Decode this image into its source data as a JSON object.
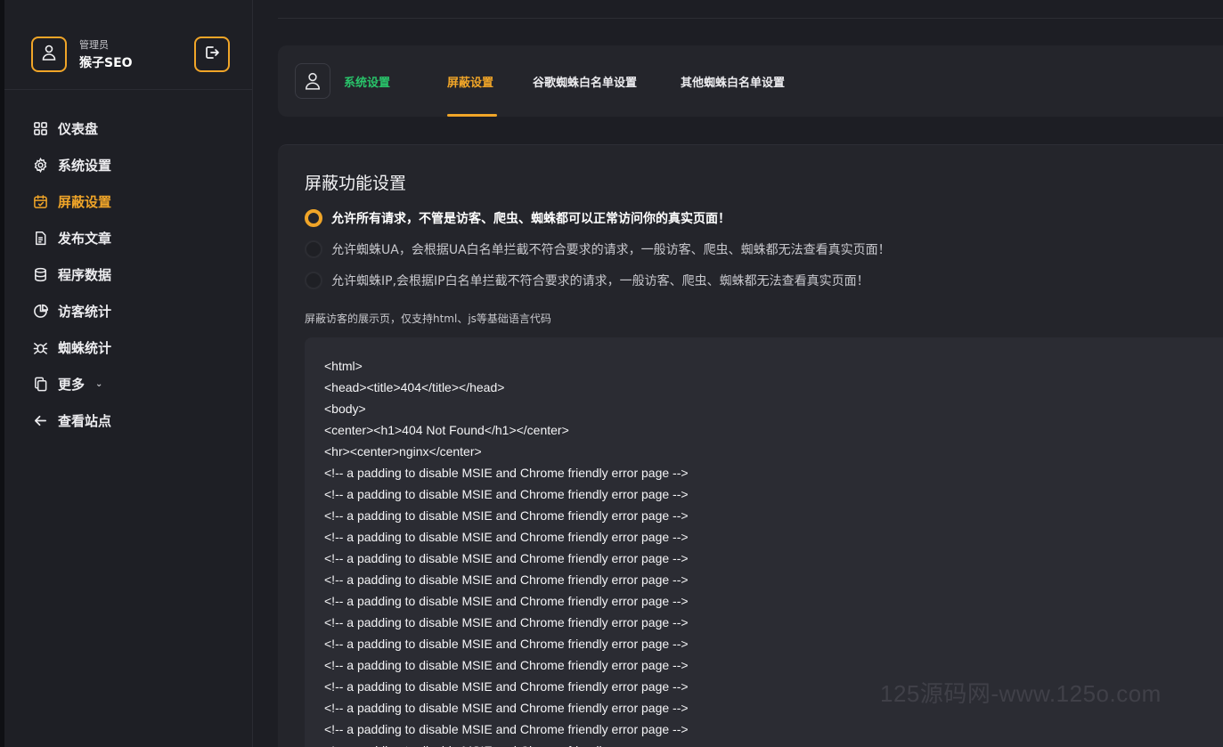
{
  "profile": {
    "role": "管理员",
    "name": "猴子SEO"
  },
  "nav": [
    {
      "label": "仪表盘"
    },
    {
      "label": "系统设置"
    },
    {
      "label": "屏蔽设置"
    },
    {
      "label": "发布文章"
    },
    {
      "label": "程序数据"
    },
    {
      "label": "访客统计"
    },
    {
      "label": "蜘蛛统计"
    },
    {
      "label": "更多"
    },
    {
      "label": "查看站点"
    }
  ],
  "tabs": [
    {
      "label": "系统设置"
    },
    {
      "label": "屏蔽设置"
    },
    {
      "label": "谷歌蜘蛛白名单设置"
    },
    {
      "label": "其他蜘蛛白名单设置"
    }
  ],
  "section": {
    "title": "屏蔽功能设置",
    "options": [
      {
        "label": "允许所有请求，不管是访客、爬虫、蜘蛛都可以正常访问你的真实页面！",
        "checked": true
      },
      {
        "label": "允许蜘蛛UA，会根据UA白名单拦截不符合要求的请求，一般访客、爬虫、蜘蛛都无法查看真实页面！",
        "checked": false
      },
      {
        "label": "允许蜘蛛IP,会根据IP白名单拦截不符合要求的请求，一般访客、爬虫、蜘蛛都无法查看真实页面！",
        "checked": false
      }
    ],
    "code_label": "屏蔽访客的展示页，仅支持html、js等基础语言代码",
    "code_lines": [
      "<html>",
      "<head><title>404</title></head>",
      "<body>",
      "<center><h1>404 Not Found</h1></center>",
      "<hr><center>nginx</center>",
      "<!-- a padding to disable MSIE and Chrome friendly error page -->",
      "<!-- a padding to disable MSIE and Chrome friendly error page -->",
      "<!-- a padding to disable MSIE and Chrome friendly error page -->",
      "<!-- a padding to disable MSIE and Chrome friendly error page -->",
      "<!-- a padding to disable MSIE and Chrome friendly error page -->",
      "<!-- a padding to disable MSIE and Chrome friendly error page -->",
      "<!-- a padding to disable MSIE and Chrome friendly error page -->",
      "<!-- a padding to disable MSIE and Chrome friendly error page -->",
      "<!-- a padding to disable MSIE and Chrome friendly error page -->",
      "<!-- a padding to disable MSIE and Chrome friendly error page -->",
      "<!-- a padding to disable MSIE and Chrome friendly error page -->",
      "<!-- a padding to disable MSIE and Chrome friendly error page -->",
      "<!-- a padding to disable MSIE and Chrome friendly error page -->",
      "<!-- a padding to disable MSIE and Chrome friendly error page -->"
    ]
  },
  "watermark": "125源码网-www.125o.com",
  "colors": {
    "accent": "#f0a528",
    "green": "#29c46a",
    "background": "#1d1e24",
    "card": "#24252b"
  },
  "icons": [
    "user-icon",
    "logout-icon",
    "dashboard-icon",
    "gear-icon",
    "calendar-icon",
    "document-icon",
    "database-icon",
    "pie-chart-icon",
    "bug-icon",
    "copy-icon",
    "arrow-left-icon",
    "chevron-down-icon"
  ]
}
